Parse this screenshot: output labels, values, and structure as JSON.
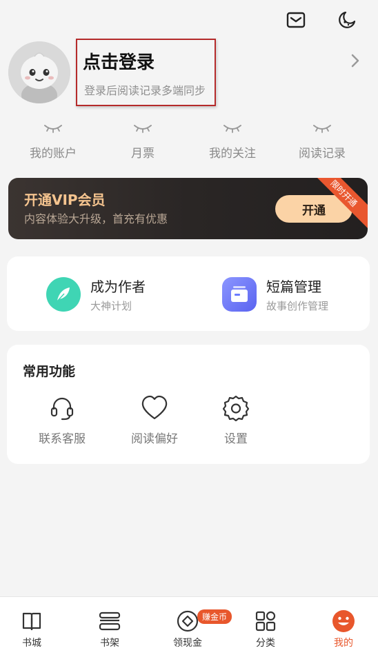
{
  "header": {
    "mail_icon": "mail-icon",
    "night_icon": "moon-icon"
  },
  "profile": {
    "login_title": "点击登录",
    "login_subtitle": "登录后阅读记录多端同步"
  },
  "quick_links": [
    {
      "label": "我的账户"
    },
    {
      "label": "月票"
    },
    {
      "label": "我的关注"
    },
    {
      "label": "阅读记录"
    }
  ],
  "vip": {
    "title": "开通VIP会员",
    "subtitle": "内容体验大升级，首充有优惠",
    "button": "开通",
    "ribbon": "限时开通",
    "accent": "#fbd3a6"
  },
  "features": [
    {
      "title": "成为作者",
      "subtitle": "大神计划",
      "icon": "feather-icon",
      "color": "#3fd5b4"
    },
    {
      "title": "短篇管理",
      "subtitle": "故事创作管理",
      "icon": "document-stack-icon",
      "color": "#6b7bff"
    }
  ],
  "tools": {
    "heading": "常用功能",
    "items": [
      {
        "label": "联系客服",
        "icon": "headset-icon"
      },
      {
        "label": "阅读偏好",
        "icon": "heart-icon"
      },
      {
        "label": "设置",
        "icon": "gear-icon"
      }
    ]
  },
  "tabbar": {
    "active_color": "#e8572c",
    "items": [
      {
        "label": "书城",
        "icon": "book-icon"
      },
      {
        "label": "书架",
        "icon": "bookshelf-icon"
      },
      {
        "label": "领现金",
        "icon": "coin-icon",
        "badge": "赚金币"
      },
      {
        "label": "分类",
        "icon": "grid-icon"
      },
      {
        "label": "我的",
        "icon": "smile-face-icon"
      }
    ]
  }
}
